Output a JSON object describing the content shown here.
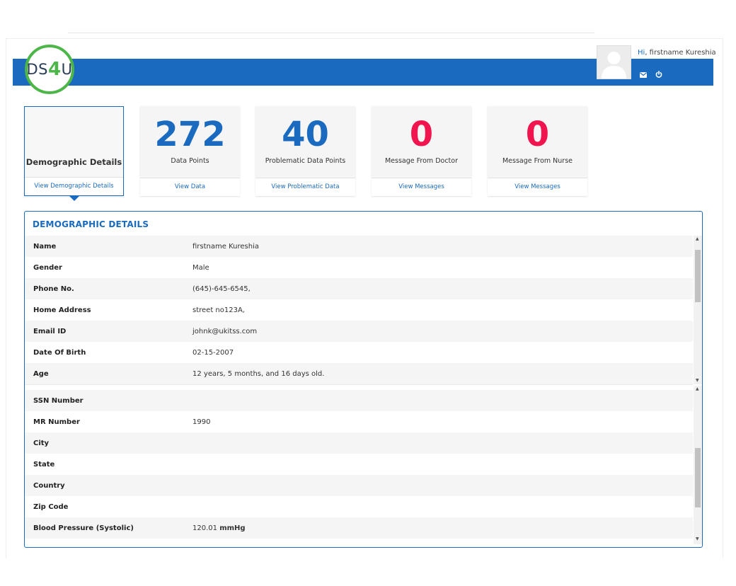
{
  "header": {
    "logo": {
      "prefix": "DS",
      "digit": "4",
      "suffix": "U"
    },
    "greeting_hi": "Hi",
    "greeting_name": ", firstname Kureshia",
    "icons": [
      "envelope-icon",
      "power-icon"
    ]
  },
  "cards": [
    {
      "title": "Demographic Details",
      "footer": "View Demographic Details",
      "selected": true
    },
    {
      "value": "272",
      "label": "Data Points",
      "footer": "View Data",
      "color": "#1a6bbf"
    },
    {
      "value": "40",
      "label": "Problematic Data Points",
      "footer": "View Problematic Data",
      "color": "#1a6bbf"
    },
    {
      "value": "0",
      "label": "Message From Doctor",
      "footer": "View Messages",
      "color": "#f0144f"
    },
    {
      "value": "0",
      "label": "Message From Nurse",
      "footer": "View Messages",
      "color": "#f0144f"
    }
  ],
  "panel": {
    "title": "DEMOGRAPHIC DETAILS",
    "section1": [
      {
        "label": "Name",
        "value": "firstname Kureshia"
      },
      {
        "label": "Gender",
        "value": "Male"
      },
      {
        "label": "Phone No.",
        "value": "(645)-645-6545,"
      },
      {
        "label": "Home Address",
        "value": "street no123A,"
      },
      {
        "label": "Email ID",
        "value": "johnk@ukitss.com"
      },
      {
        "label": "Date Of Birth",
        "value": "02-15-2007"
      },
      {
        "label": "Age",
        "value": "12 years, 5 months, and 16 days old."
      }
    ],
    "section2": [
      {
        "label": "SSN Number",
        "value": ""
      },
      {
        "label": "MR Number",
        "value": "1990"
      },
      {
        "label": "City",
        "value": ""
      },
      {
        "label": "State",
        "value": ""
      },
      {
        "label": "Country",
        "value": ""
      },
      {
        "label": "Zip Code",
        "value": ""
      },
      {
        "label": "Blood Pressure (Systolic)",
        "value": "120.01",
        "unit": "mmHg"
      }
    ]
  },
  "colors": {
    "primary": "#1a6bbf",
    "alert": "#f0144f",
    "logo_green": "#4cb648"
  }
}
